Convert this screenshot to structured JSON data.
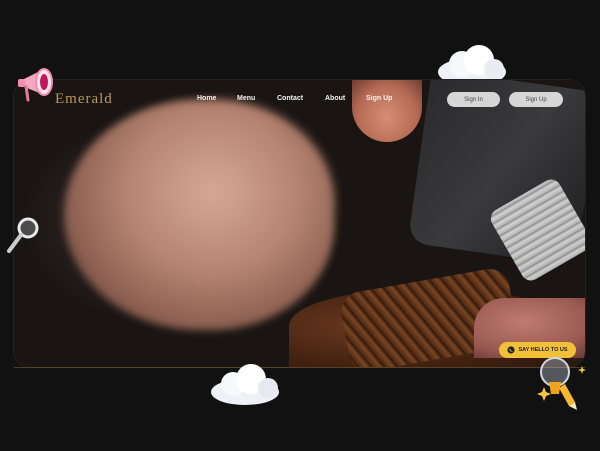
{
  "brand": {
    "name": "Emerald",
    "color": "#b9995b"
  },
  "nav": [
    {
      "label": "Home"
    },
    {
      "label": "Menu"
    },
    {
      "label": "Contact"
    },
    {
      "label": "About"
    },
    {
      "label": "Sign Up"
    }
  ],
  "auth": {
    "signin_label": "Sign In",
    "signup_label": "Sign Up"
  },
  "cta": {
    "label": "SAY HELLO TO US",
    "color": "#f2c037"
  },
  "icons": [
    "megaphone-icon",
    "magnifier-icon",
    "cloud-icon",
    "lightbulb-icon",
    "whatsapp-icon",
    "sparkle-icon"
  ],
  "colors": {
    "background": "#111111",
    "button": "#d6d6d6"
  }
}
